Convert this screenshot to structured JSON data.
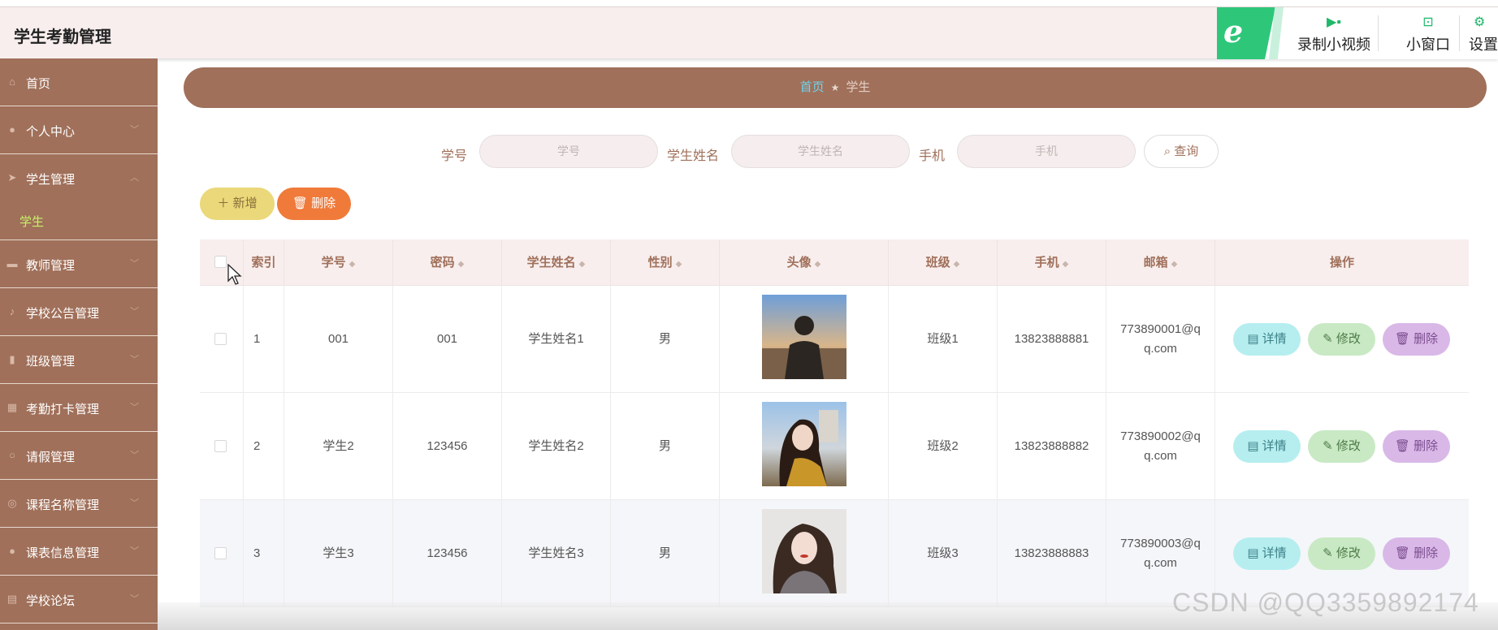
{
  "app": {
    "title": "学生考勤管理"
  },
  "toolbar": {
    "record_label": "录制小视频",
    "mini_label": "小窗口",
    "settings_label": "设置"
  },
  "sidebar": {
    "items": [
      {
        "label": "首页",
        "icon": "home-icon"
      },
      {
        "label": "个人中心",
        "icon": "user-icon"
      },
      {
        "label": "学生管理",
        "icon": "send-icon"
      },
      {
        "label": "教师管理",
        "icon": "chat-icon"
      },
      {
        "label": "学校公告管理",
        "icon": "mic-icon"
      },
      {
        "label": "班级管理",
        "icon": "chart-icon"
      },
      {
        "label": "考勤打卡管理",
        "icon": "calendar-icon"
      },
      {
        "label": "请假管理",
        "icon": "search-icon"
      },
      {
        "label": "课程名称管理",
        "icon": "target-icon"
      },
      {
        "label": "课表信息管理",
        "icon": "location-icon"
      },
      {
        "label": "学校论坛",
        "icon": "list-icon"
      }
    ],
    "sub_active": "学生"
  },
  "breadcrumb": {
    "home": "首页",
    "current": "学生"
  },
  "search": {
    "student_no_label": "学号",
    "student_no_placeholder": "学号",
    "name_label": "学生姓名",
    "name_placeholder": "学生姓名",
    "phone_label": "手机",
    "phone_placeholder": "手机",
    "query_label": "查询"
  },
  "actions": {
    "add_label": "新增",
    "delete_label": "删除"
  },
  "table": {
    "headers": [
      "索引",
      "学号",
      "密码",
      "学生姓名",
      "性别",
      "头像",
      "班级",
      "手机",
      "邮箱",
      "操作"
    ],
    "rows": [
      {
        "index": "1",
        "no": "001",
        "password": "001",
        "name": "学生姓名1",
        "gender": "男",
        "class": "班级1",
        "phone": "13823888881",
        "email1": "773890001@q",
        "email2": "q.com"
      },
      {
        "index": "2",
        "no": "学生2",
        "password": "123456",
        "name": "学生姓名2",
        "gender": "男",
        "class": "班级2",
        "phone": "13823888882",
        "email1": "773890002@q",
        "email2": "q.com"
      },
      {
        "index": "3",
        "no": "学生3",
        "password": "123456",
        "name": "学生姓名3",
        "gender": "男",
        "class": "班级3",
        "phone": "13823888883",
        "email1": "773890003@q",
        "email2": "q.com"
      }
    ],
    "row_actions": {
      "detail": "详情",
      "edit": "修改",
      "delete": "删除"
    }
  },
  "watermark": "CSDN @QQ3359892174"
}
